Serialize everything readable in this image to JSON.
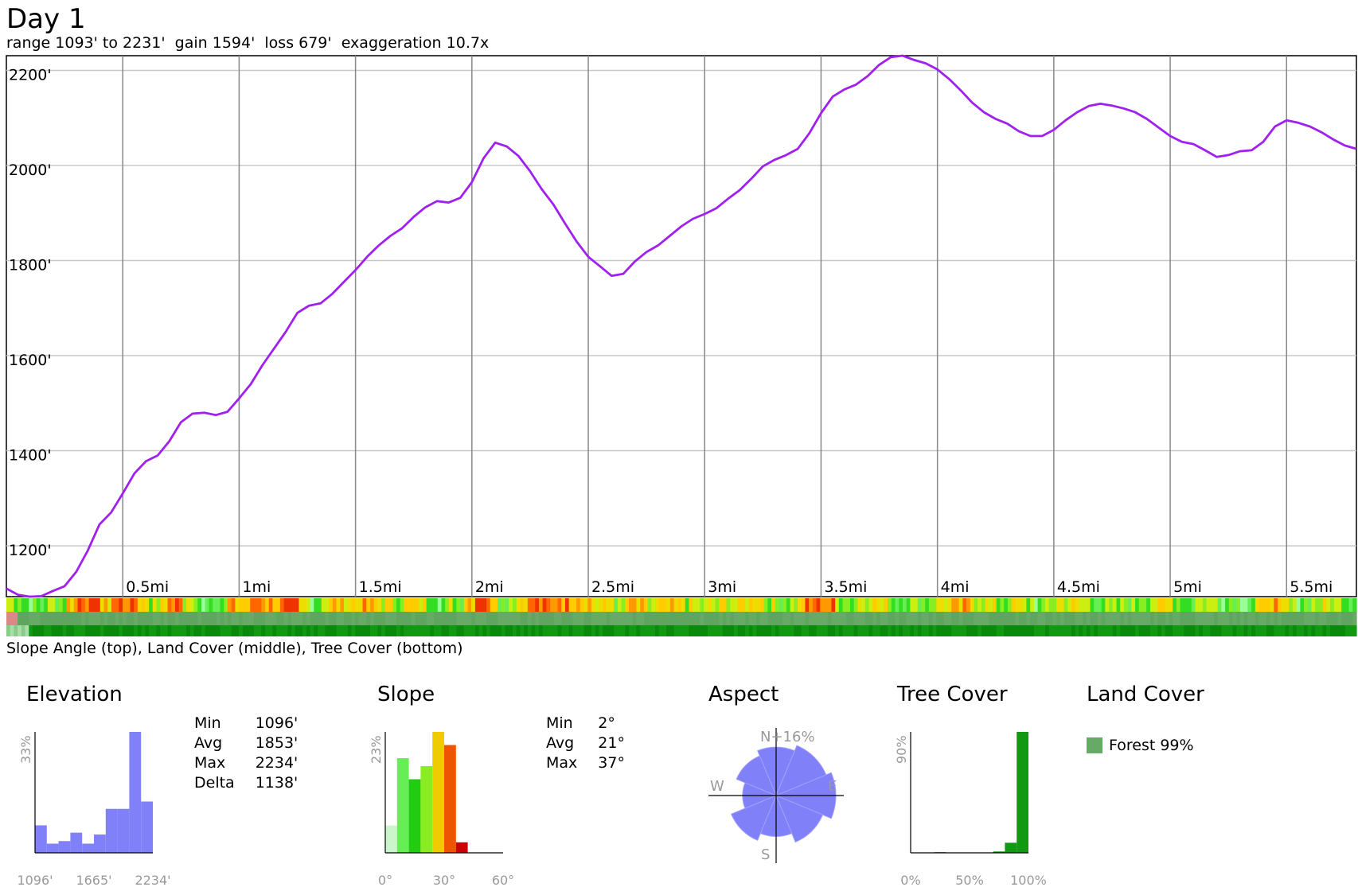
{
  "header": {
    "title": "Day 1",
    "subtitle": "range 1093' to 2231'  gain 1594'  loss 679'  exaggeration 10.7x"
  },
  "strip_caption": "Slope Angle (top), Land Cover (middle), Tree Cover (bottom)",
  "colors": {
    "profile_line": "#a020f0",
    "grid": "#c8c8c8",
    "vertical_grid": "#888888",
    "histogram_purple": "#8080f8",
    "tree_green": "#119911",
    "forest": "#66aa66"
  },
  "chart_data": [
    {
      "type": "line",
      "title": "Day 1",
      "x": [
        0.0,
        0.05,
        0.1,
        0.15,
        0.2,
        0.25,
        0.3,
        0.35,
        0.4,
        0.45,
        0.5,
        0.55,
        0.6,
        0.65,
        0.7,
        0.75,
        0.8,
        0.85,
        0.9,
        0.95,
        1.0,
        1.05,
        1.1,
        1.15,
        1.2,
        1.25,
        1.3,
        1.35,
        1.4,
        1.45,
        1.5,
        1.55,
        1.6,
        1.65,
        1.7,
        1.75,
        1.8,
        1.85,
        1.9,
        1.95,
        2.0,
        2.05,
        2.1,
        2.15,
        2.2,
        2.25,
        2.3,
        2.35,
        2.4,
        2.45,
        2.5,
        2.55,
        2.6,
        2.65,
        2.7,
        2.75,
        2.8,
        2.85,
        2.9,
        2.95,
        3.0,
        3.05,
        3.1,
        3.15,
        3.2,
        3.25,
        3.3,
        3.35,
        3.4,
        3.45,
        3.5,
        3.55,
        3.6,
        3.65,
        3.7,
        3.75,
        3.8,
        3.85,
        3.9,
        3.95,
        4.0,
        4.05,
        4.1,
        4.15,
        4.2,
        4.25,
        4.3,
        4.35,
        4.4,
        4.45,
        4.5,
        4.55,
        4.6,
        4.65,
        4.7,
        4.75,
        4.8,
        4.85,
        4.9,
        4.95,
        5.0,
        5.05,
        5.1,
        5.15,
        5.2,
        5.25,
        5.3,
        5.35,
        5.4,
        5.45,
        5.5,
        5.55,
        5.6,
        5.65,
        5.7,
        5.75,
        5.8
      ],
      "series": [
        {
          "values": [
            1110,
            1097,
            1093,
            1094,
            1105,
            1115,
            1145,
            1190,
            1245,
            1270,
            1310,
            1352,
            1378,
            1390,
            1420,
            1460,
            1478,
            1480,
            1475,
            1482,
            1510,
            1540,
            1580,
            1615,
            1650,
            1690,
            1705,
            1710,
            1730,
            1755,
            1780,
            1808,
            1832,
            1852,
            1868,
            1892,
            1912,
            1925,
            1922,
            1932,
            1965,
            2015,
            2048,
            2040,
            2020,
            1988,
            1950,
            1918,
            1878,
            1840,
            1808,
            1788,
            1768,
            1772,
            1798,
            1818,
            1832,
            1852,
            1872,
            1888,
            1898,
            1910,
            1930,
            1948,
            1972,
            1998,
            2012,
            2022,
            2035,
            2068,
            2110,
            2145,
            2160,
            2170,
            2188,
            2212,
            2228,
            2231,
            2222,
            2215,
            2202,
            2182,
            2158,
            2132,
            2112,
            2098,
            2088,
            2072,
            2062,
            2062,
            2075,
            2095,
            2112,
            2125,
            2130,
            2126,
            2120,
            2112,
            2098,
            2080,
            2062,
            2050,
            2045,
            2032,
            2018,
            2022,
            2030,
            2032,
            2050,
            2082,
            2095,
            2090,
            2082,
            2070,
            2055,
            2042,
            2035
          ]
        }
      ],
      "x_ticks": [
        "0.5mi",
        "1mi",
        "1.5mi",
        "2mi",
        "2.5mi",
        "3mi",
        "3.5mi",
        "4mi",
        "4.5mi",
        "5mi",
        "5.5mi"
      ],
      "x_tick_values": [
        0.5,
        1.0,
        1.5,
        2.0,
        2.5,
        3.0,
        3.5,
        4.0,
        4.5,
        5.0,
        5.5
      ],
      "y_ticks": [
        "1200'",
        "1400'",
        "1600'",
        "1800'",
        "2000'",
        "2200'"
      ],
      "y_tick_values": [
        1200,
        1400,
        1600,
        1800,
        2000,
        2200
      ],
      "xlim": [
        0,
        5.8
      ],
      "ylim": [
        1093,
        2231
      ],
      "grid": true
    },
    {
      "type": "bar",
      "title": "Elevation",
      "ylabel": "33%",
      "x_ticks": [
        "1096'",
        "1665'",
        "2234'"
      ],
      "values": [
        0.075,
        0.025,
        0.032,
        0.055,
        0.025,
        0.05,
        0.12,
        0.12,
        0.33,
        0.14
      ],
      "ylim": [
        0,
        0.33
      ]
    },
    {
      "type": "bar",
      "title": "Slope",
      "ylabel": "23%",
      "x_ticks": [
        "0°",
        "30°",
        "60°"
      ],
      "values": [
        0.052,
        0.18,
        0.14,
        0.165,
        0.23,
        0.205,
        0.02,
        0,
        0,
        0
      ],
      "colors": [
        "#ccf5cc",
        "#66ee55",
        "#22cc11",
        "#88ee22",
        "#eecc00",
        "#ee5500",
        "#cc0000",
        "#cc0000",
        "#cc0000",
        "#cc0000"
      ],
      "ylim": [
        0,
        0.23
      ]
    },
    {
      "type": "pie",
      "title": "Aspect",
      "label_top": "N+16%",
      "labels": [
        "N",
        "NE",
        "E",
        "SE",
        "S",
        "SW",
        "W",
        "NW"
      ],
      "values": [
        0.13,
        0.145,
        0.16,
        0.135,
        0.11,
        0.13,
        0.09,
        0.115
      ],
      "compass": [
        "W",
        "E",
        "S"
      ]
    },
    {
      "type": "bar",
      "title": "Tree Cover",
      "ylabel": "90%",
      "x_ticks": [
        "0%",
        "50%",
        "100%"
      ],
      "values": [
        0,
        0,
        0.005,
        0,
        0,
        0,
        0,
        0.01,
        0.075,
        0.9
      ],
      "ylim": [
        0,
        0.9
      ]
    }
  ],
  "elevation_stats": [
    {
      "label": "Min",
      "value": "1096'"
    },
    {
      "label": "Avg",
      "value": "1853'"
    },
    {
      "label": "Max",
      "value": "2234'"
    },
    {
      "label": "Delta",
      "value": "1138'"
    }
  ],
  "slope_stats": [
    {
      "label": "Min",
      "value": "2°"
    },
    {
      "label": "Avg",
      "value": "21°"
    },
    {
      "label": "Max",
      "value": "37°"
    }
  ],
  "land_cover": {
    "title": "Land Cover",
    "items": [
      {
        "label": "Forest 99%",
        "color": "#66aa66"
      }
    ]
  }
}
